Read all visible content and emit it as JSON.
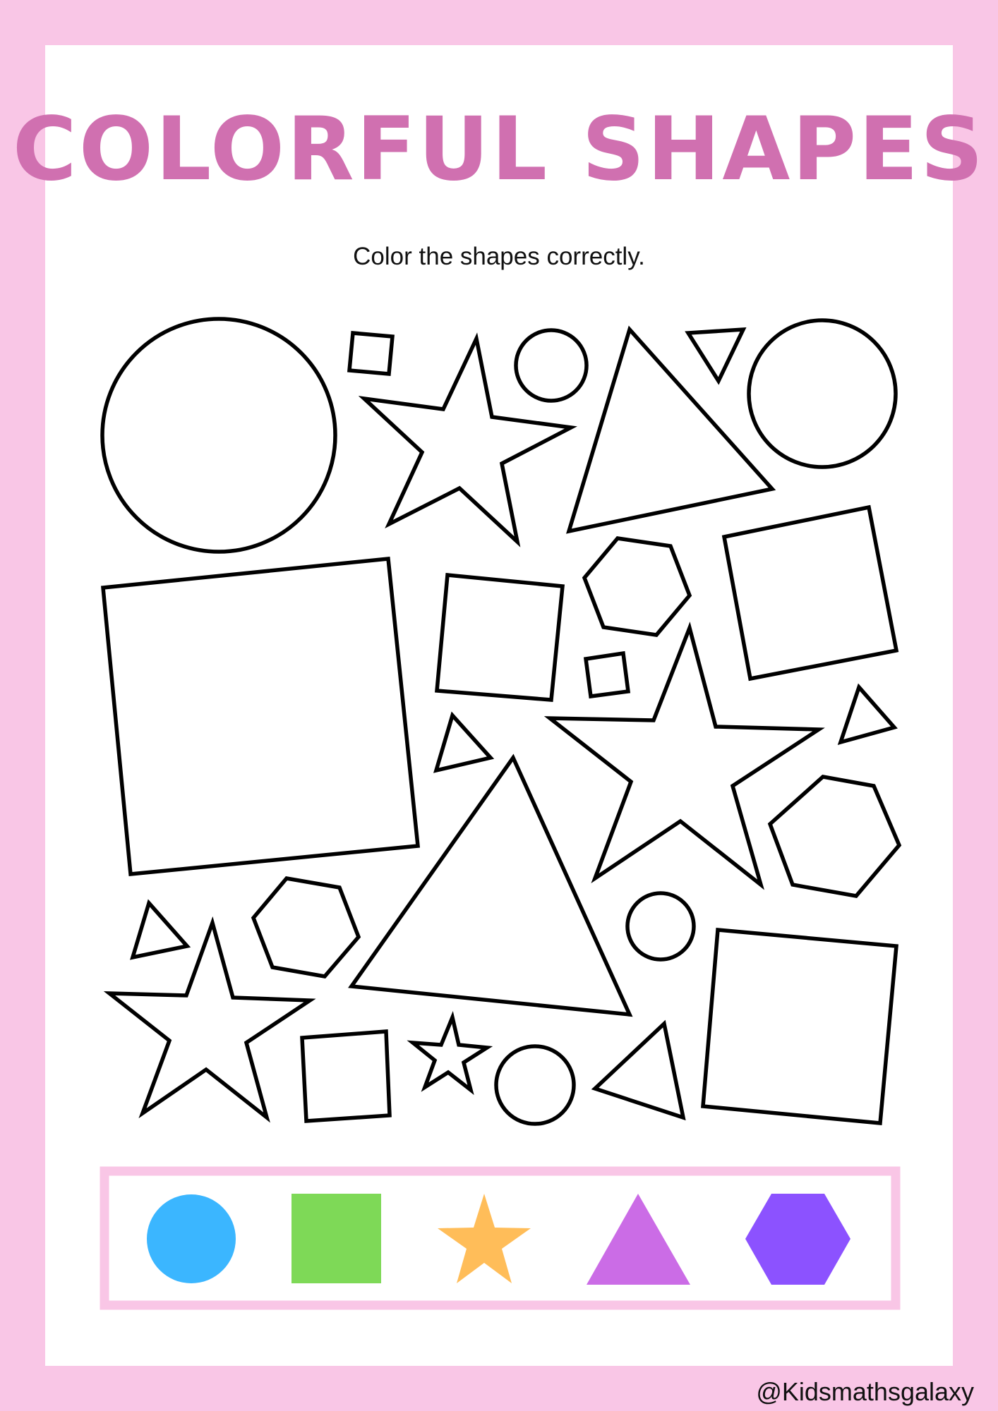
{
  "title": "COLORFUL SHAPES",
  "instruction": "Color the shapes correctly.",
  "credit": "@Kidsmathsgalaxy",
  "colors": {
    "page_border": "#f9c6e6",
    "title": "#d070b0",
    "key_border": "#f9c6e6"
  },
  "color_key": [
    {
      "shape": "circle",
      "color": "#3bb6ff"
    },
    {
      "shape": "square",
      "color": "#7ed957"
    },
    {
      "shape": "star",
      "color": "#ffbd59"
    },
    {
      "shape": "triangle",
      "color": "#cb6ce6"
    },
    {
      "shape": "hexagon",
      "color": "#8c52ff"
    }
  ]
}
